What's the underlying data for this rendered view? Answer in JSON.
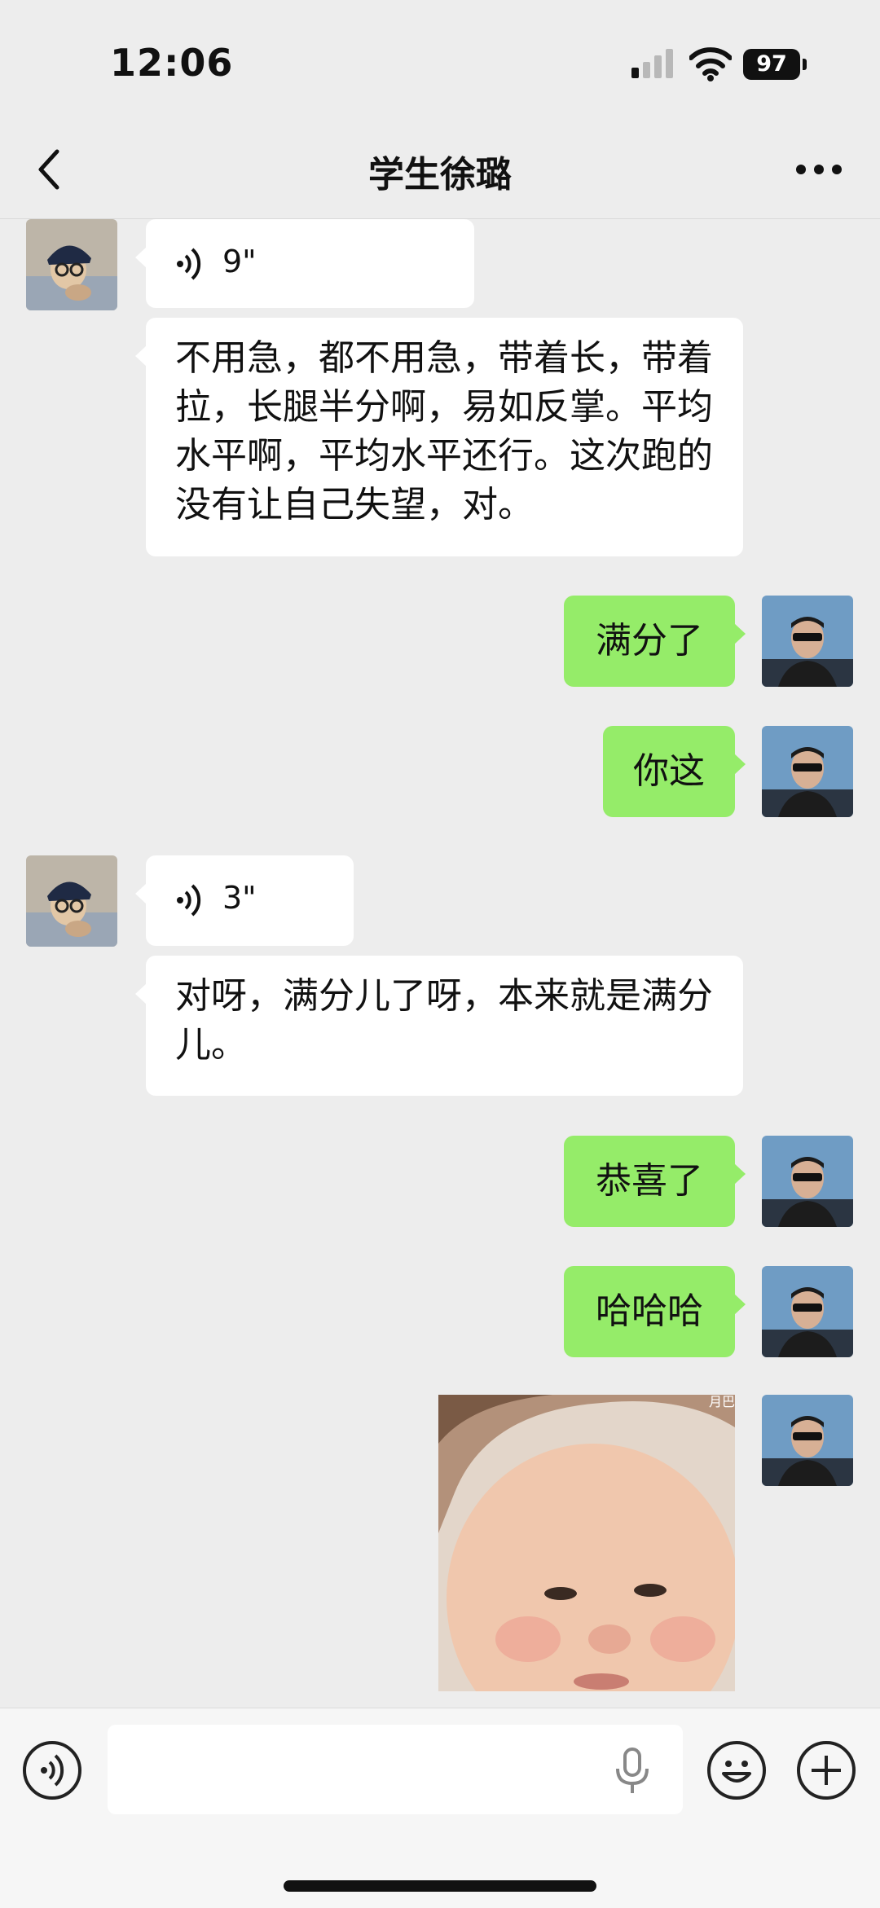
{
  "status_bar": {
    "time": "12:06",
    "battery": "97"
  },
  "nav": {
    "title": "学生徐璐"
  },
  "messages": [
    {
      "side": "in",
      "type": "voice",
      "duration": "9\""
    },
    {
      "side": "in",
      "type": "text",
      "text": "不用急，都不用急，带着长，带着拉，长腿半分啊，易如反掌。平均水平啊，平均水平还行。这次跑的没有让自己失望，对。"
    },
    {
      "side": "out",
      "type": "text",
      "text": "满分了"
    },
    {
      "side": "out",
      "type": "text",
      "text": "你这"
    },
    {
      "side": "in",
      "type": "voice",
      "duration": "3\""
    },
    {
      "side": "in",
      "type": "text",
      "text": "对呀，满分儿了呀，本来就是满分儿。"
    },
    {
      "side": "out",
      "type": "text",
      "text": "恭喜了"
    },
    {
      "side": "out",
      "type": "text",
      "text": "哈哈哈"
    },
    {
      "side": "out",
      "type": "sticker",
      "watermark": "月巴"
    }
  ],
  "input": {
    "placeholder": ""
  },
  "colors": {
    "outgoing_bubble": "#95ec69",
    "incoming_bubble": "#ffffff",
    "background": "#ededed"
  },
  "icons": {
    "back": "chevron-left-icon",
    "more": "more-dots-icon",
    "voice_toggle": "voice-toggle-icon",
    "mic": "microphone-icon",
    "emoji": "emoji-icon",
    "add": "add-icon"
  }
}
